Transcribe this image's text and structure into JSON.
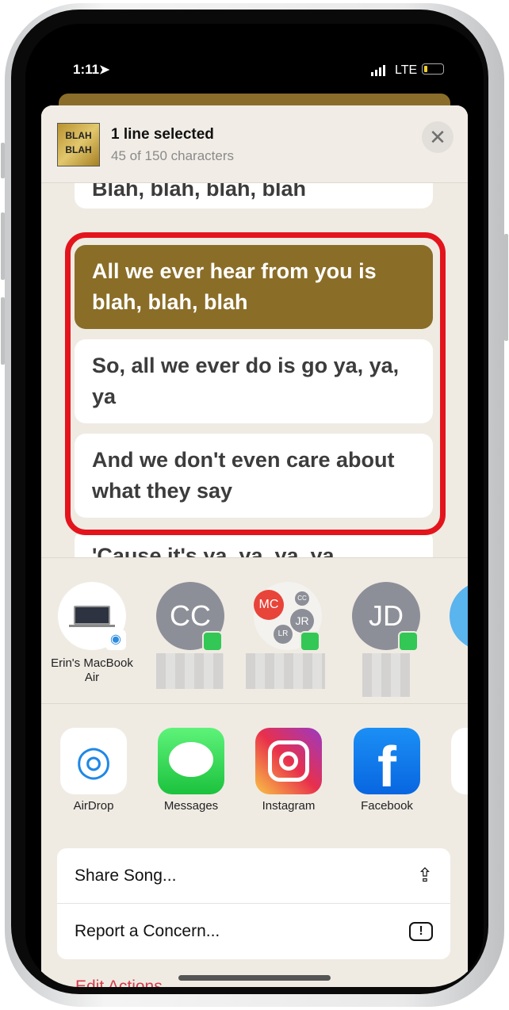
{
  "status": {
    "time": "1:11",
    "network": "LTE",
    "battery_level": 0.2
  },
  "header": {
    "title": "1 line selected",
    "subtitle": "45 of 150 characters",
    "album_art_text": "BLAH BLAH"
  },
  "lyrics": [
    {
      "text": "Blah, blah, blah, blah",
      "selected": false
    },
    {
      "text": "All we ever hear from you is blah, blah, blah",
      "selected": true
    },
    {
      "text": "So, all we ever do is go ya, ya, ya",
      "selected": false
    },
    {
      "text": "And we don't even care about what they say",
      "selected": false
    },
    {
      "text": "'Cause it's ya, ya, ya, ya",
      "selected": false
    }
  ],
  "people": [
    {
      "initials": "",
      "label": "Erin's MacBook Air",
      "type": "airdrop-device"
    },
    {
      "initials": "CC",
      "label": ""
    },
    {
      "initials": "MC",
      "group": [
        "MC",
        "CC",
        "JR",
        "LR"
      ],
      "label": ""
    },
    {
      "initials": "JD",
      "label": ""
    }
  ],
  "apps": [
    {
      "label": "AirDrop"
    },
    {
      "label": "Messages"
    },
    {
      "label": "Instagram"
    },
    {
      "label": "Facebook"
    }
  ],
  "menu": [
    {
      "label": "Share Song...",
      "icon": "share-icon"
    },
    {
      "label": "Report a Concern...",
      "icon": "report-icon"
    }
  ],
  "edit_actions": "Edit Actions",
  "colors": {
    "selected": "#8a6d27",
    "highlight": "#e4141c",
    "accent": "#d63a4a"
  }
}
